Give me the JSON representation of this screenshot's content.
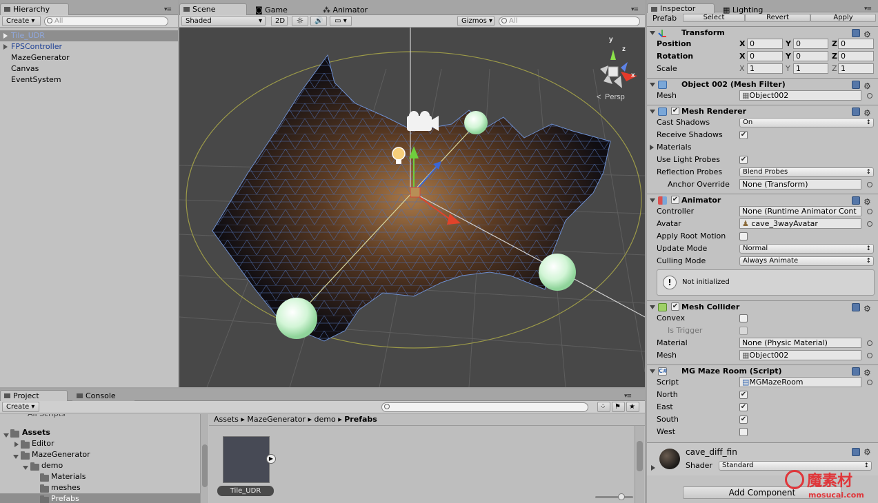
{
  "hierarchy": {
    "tab": "Hierarchy",
    "create": "Create",
    "search_placeholder": "All",
    "items": [
      "Tile_UDR",
      "FPSController",
      "MazeGenerator",
      "Canvas",
      "EventSystem"
    ]
  },
  "scene": {
    "tabs": [
      "Scene",
      "Game",
      "Animator"
    ],
    "shading": "Shaded",
    "mode_2d": "2D",
    "gizmos": "Gizmos",
    "search_placeholder": "All",
    "gizmo_axes": {
      "y": "y",
      "z": "z",
      "x": "x"
    },
    "persp": "Persp"
  },
  "project": {
    "tabs": [
      "Project",
      "Console"
    ],
    "create": "Create",
    "partial_item": "All Scripts",
    "tree": [
      {
        "label": "Assets",
        "bold": true
      },
      {
        "label": "Editor"
      },
      {
        "label": "MazeGenerator"
      },
      {
        "label": "demo"
      },
      {
        "label": "Materials"
      },
      {
        "label": "meshes"
      },
      {
        "label": "Prefabs"
      }
    ],
    "breadcrumb": [
      "Assets",
      "MazeGenerator",
      "demo",
      "Prefabs"
    ],
    "asset_label": "Tile_UDR"
  },
  "inspector": {
    "tabs": [
      "Inspector",
      "Lighting"
    ],
    "prefab_label": "Prefab",
    "prefab_buttons": [
      "Select",
      "Revert",
      "Apply"
    ],
    "transform": {
      "title": "Transform",
      "position": {
        "label": "Position",
        "x": "0",
        "y": "0",
        "z": "0"
      },
      "rotation": {
        "label": "Rotation",
        "x": "0",
        "y": "0",
        "z": "0"
      },
      "scale": {
        "label": "Scale",
        "x": "1",
        "y": "1",
        "z": "1"
      }
    },
    "mesh_filter": {
      "title": "Object 002 (Mesh Filter)",
      "mesh_label": "Mesh",
      "mesh_value": "Object002"
    },
    "mesh_renderer": {
      "title": "Mesh Renderer",
      "cast_shadows": {
        "label": "Cast Shadows",
        "value": "On"
      },
      "receive_shadows": {
        "label": "Receive Shadows",
        "checked": true
      },
      "materials": "Materials",
      "use_light_probes": {
        "label": "Use Light Probes",
        "checked": true
      },
      "reflection_probes": {
        "label": "Reflection Probes",
        "value": "Blend Probes"
      },
      "anchor_override": {
        "label": "Anchor Override",
        "value": "None (Transform)"
      }
    },
    "animator": {
      "title": "Animator",
      "controller": {
        "label": "Controller",
        "value": "None (Runtime Animator Cont"
      },
      "avatar": {
        "label": "Avatar",
        "value": "cave_3wayAvatar"
      },
      "apply_root_motion": {
        "label": "Apply Root Motion",
        "checked": false
      },
      "update_mode": {
        "label": "Update Mode",
        "value": "Normal"
      },
      "culling_mode": {
        "label": "Culling Mode",
        "value": "Always Animate"
      },
      "notice": "Not initialized"
    },
    "mesh_collider": {
      "title": "Mesh Collider",
      "convex": {
        "label": "Convex",
        "checked": false
      },
      "is_trigger": {
        "label": "Is Trigger",
        "checked": false
      },
      "material": {
        "label": "Material",
        "value": "None (Physic Material)"
      },
      "mesh": {
        "label": "Mesh",
        "value": "Object002"
      }
    },
    "maze_room": {
      "title": "MG Maze Room (Script)",
      "script": {
        "label": "Script",
        "value": "MGMazeRoom"
      },
      "north": {
        "label": "North",
        "checked": true
      },
      "east": {
        "label": "East",
        "checked": true
      },
      "south": {
        "label": "South",
        "checked": true
      },
      "west": {
        "label": "West",
        "checked": false
      }
    },
    "material": {
      "name": "cave_diff_fin",
      "shader_label": "Shader",
      "shader_value": "Standard"
    },
    "add_component": "Add Component"
  },
  "watermark": {
    "brand": "魔素材",
    "site": "mosucai.com"
  },
  "colors": {
    "selection": "#3d6fb8",
    "link_blue": "#1c3f94",
    "scene_bg": "#484848",
    "watermark_red": "#e0363a"
  }
}
